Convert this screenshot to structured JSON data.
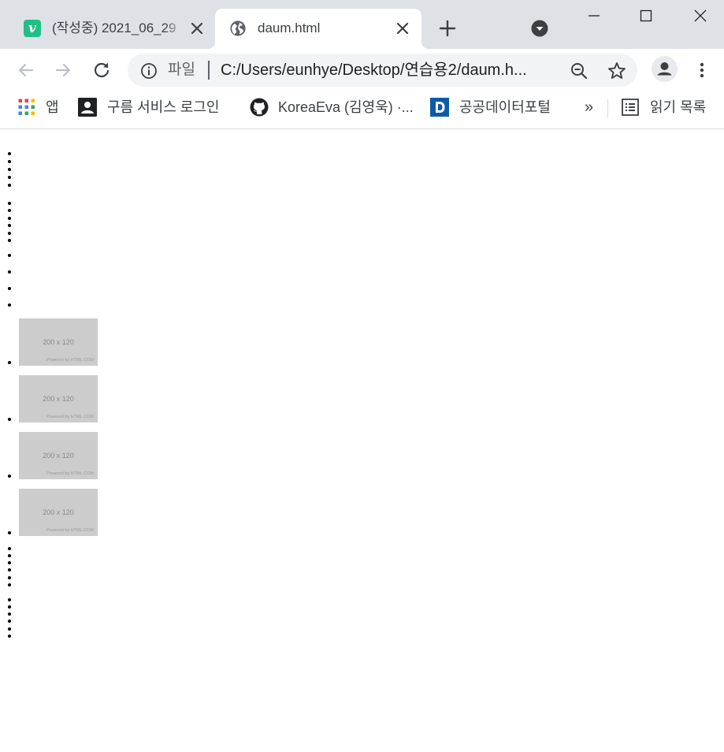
{
  "browser": {
    "tabs": [
      {
        "title": "(작성중) 2021_06_29",
        "favicon": "velog-v-icon",
        "favicon_letter": "v",
        "active": false
      },
      {
        "title": "daum.html",
        "favicon": "globe-icon",
        "active": true
      }
    ],
    "address_bar": {
      "security_chip": "파일",
      "url": "C:/Users/eunhye/Desktop/연습용2/daum.h..."
    },
    "bookmarks": [
      {
        "label": "앱",
        "icon": "apps-grid-icon"
      },
      {
        "label": "구름 서비스 로그인",
        "icon": "account-box-icon"
      },
      {
        "label": "KoreaEva (김영욱) ·...",
        "icon": "github-icon"
      },
      {
        "label": "공공데이터포털",
        "icon": "data-portal-icon"
      }
    ],
    "bookmarks_overflow": "»",
    "reading_list": {
      "label": "읽기 목록",
      "icon": "reading-list-icon"
    }
  },
  "page": {
    "images": [
      {
        "size_text": "200 x 120",
        "powered_text": "Powered by HTML.COM"
      },
      {
        "size_text": "200 x 120",
        "powered_text": "Powered by HTML.COM"
      },
      {
        "size_text": "200 x 120",
        "powered_text": "Powered by HTML.COM"
      },
      {
        "size_text": "200 x 120",
        "powered_text": "Powered by HTML.COM"
      }
    ]
  },
  "colors": {
    "tabstrip_bg": "#dee1e6",
    "omnibox_bg": "#f1f3f4",
    "velog_green": "#20bf86",
    "placeholder_gray": "#cccccc",
    "data_portal_blue": "#0e5aa7"
  }
}
